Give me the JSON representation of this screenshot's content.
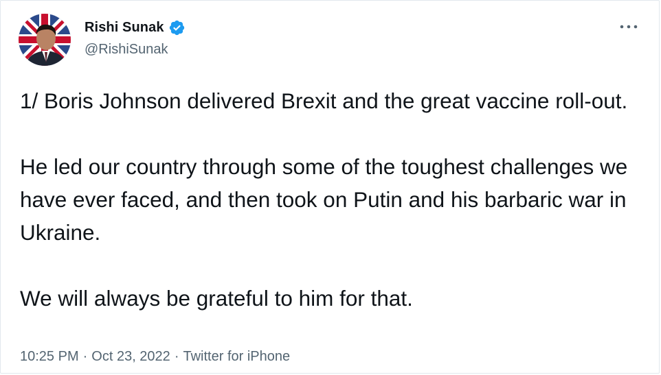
{
  "author": {
    "display_name": "Rishi Sunak",
    "handle": "@RishiSunak",
    "verified": true
  },
  "tweet": {
    "paragraphs": [
      "1/ Boris Johnson delivered Brexit and the great vaccine roll-out.",
      "He led our country through some of the toughest challenges we have ever faced, and then took on Putin and his barbaric war in Ukraine.",
      "We will always be grateful to him for that."
    ],
    "time": "10:25 PM",
    "date": "Oct 23, 2022",
    "source": "Twitter for iPhone",
    "separator": "·"
  },
  "icons": {
    "more": "more-options-icon",
    "verified": "verified-badge-icon"
  },
  "colors": {
    "text": "#0f1419",
    "secondary": "#536471",
    "verified_blue": "#1d9bf0",
    "border": "#e1e8ed"
  }
}
